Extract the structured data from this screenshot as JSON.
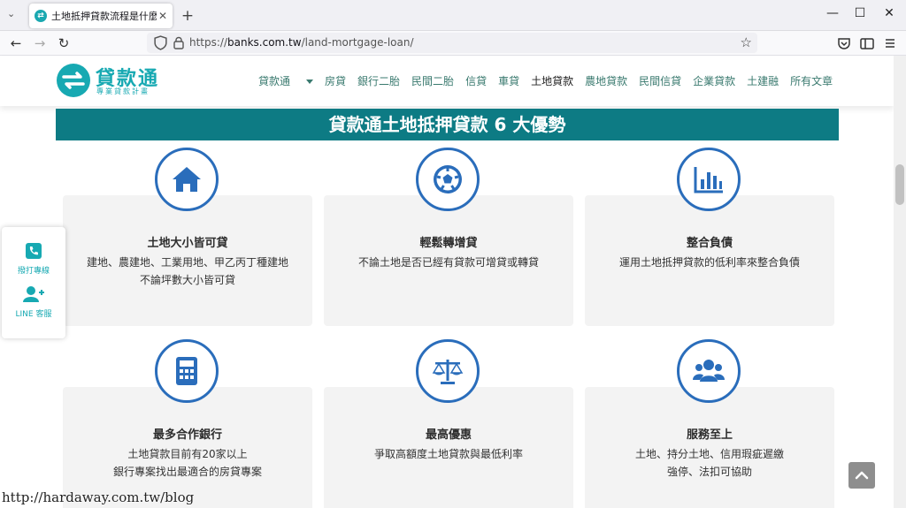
{
  "browser": {
    "tab_title": "土地抵押貸款流程是什麼?只要",
    "url_prefix": "https://",
    "url_host": "banks.com.tw",
    "url_path": "/land-mortgage-loan/"
  },
  "site": {
    "logo_name": "貸款通",
    "logo_tagline": "專業貸款計畫",
    "menu": [
      {
        "label": "貸款通"
      },
      {
        "label": "房貸"
      },
      {
        "label": "銀行二胎"
      },
      {
        "label": "民間二胎"
      },
      {
        "label": "信貸"
      },
      {
        "label": "車貸"
      },
      {
        "label": "土地貸款"
      },
      {
        "label": "農地貸款"
      },
      {
        "label": "民間信貸"
      },
      {
        "label": "企業貸款"
      },
      {
        "label": "土建融"
      },
      {
        "label": "所有文章"
      }
    ]
  },
  "banner": {
    "title": "貸款通土地抵押貸款 6 大優勢"
  },
  "cards": [
    {
      "icon": "house-icon",
      "title": "土地大小皆可貸",
      "desc1": "建地、農建地、工業用地、甲乙丙丁種建地",
      "desc2": "不論坪數大小皆可貸"
    },
    {
      "icon": "soccer-ball-icon",
      "title": "輕鬆轉增貸",
      "desc1": "不論土地是否已經有貸款可增貸或轉貸",
      "desc2": ""
    },
    {
      "icon": "bar-chart-icon",
      "title": "整合負債",
      "desc1": "運用土地抵押貸款的低利率來整合負債",
      "desc2": ""
    },
    {
      "icon": "calculator-icon",
      "title": "最多合作銀行",
      "desc1": "土地貸款目前有20家以上",
      "desc2": "銀行專案找出最適合的房貸專案"
    },
    {
      "icon": "scale-icon",
      "title": "最高優惠",
      "desc1": "爭取高額度土地貸款與最低利率",
      "desc2": ""
    },
    {
      "icon": "users-icon",
      "title": "服務至上",
      "desc1": "土地、持分土地、信用瑕疵遲繳",
      "desc2": "強停、法扣可協助"
    }
  ],
  "float_panel": {
    "call_label": "撥打專線",
    "line_label": "LINE 客服"
  },
  "watermark": "http://hardaway.com.tw/blog",
  "colors": {
    "brand_teal": "#17a9b2",
    "banner_teal": "#0d7b84",
    "icon_blue": "#2a6dbb"
  }
}
